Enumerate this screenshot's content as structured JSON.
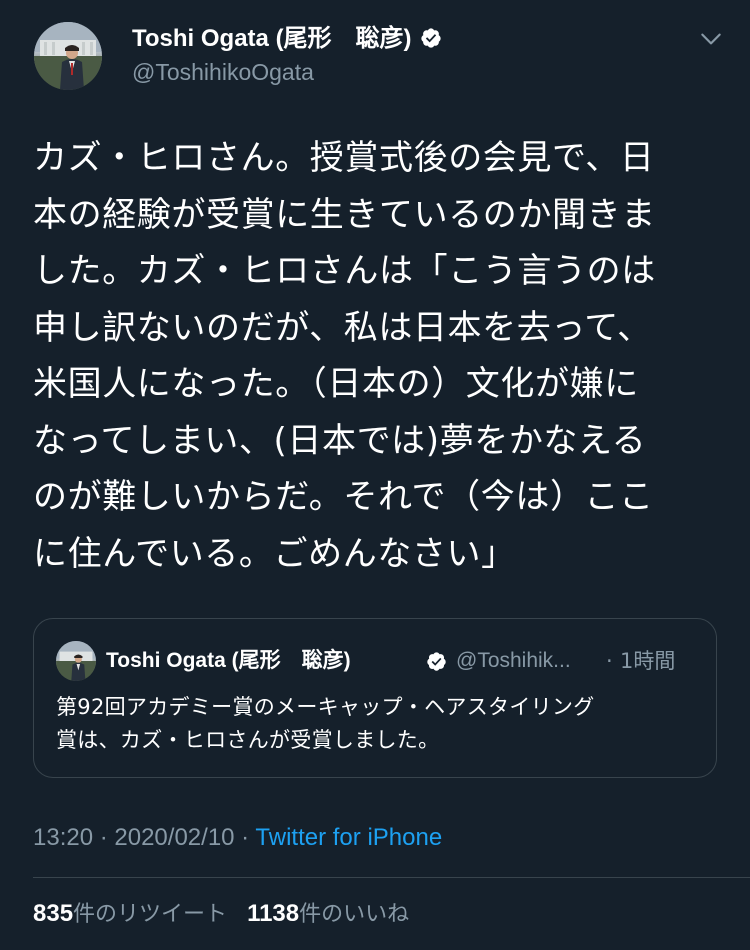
{
  "author": {
    "name": "Toshi Ogata (尾形　聡彦)",
    "handle": "@ToshihikoOgata",
    "verified": true
  },
  "tweet": {
    "lines": [
      "カズ・ヒロさん。授賞式後の会見で、日",
      "本の経験が受賞に生きているのか聞きま",
      "した。カズ・ヒロさんは「こう言うのは",
      "申し訳ないのだが、私は日本を去って、",
      "米国人になった。（日本の）文化が嫌に",
      "なってしまい、(日本では)夢をかなえる",
      "のが難しいからだ。それで（今は）ここ",
      "に住んでいる。ごめんなさい」"
    ]
  },
  "quoted_tweet": {
    "name": "Toshi Ogata (尾形　聡彦)",
    "handle": "@Toshihik...",
    "separator": "·",
    "time": "1時間",
    "lines": [
      "第92回アカデミー賞のメーキャップ・ヘアスタイリング",
      "賞は、カズ・ヒロさんが受賞しました。"
    ]
  },
  "meta": {
    "time": "13:20",
    "sep1": " · ",
    "date": "2020/02/10",
    "sep2": " · ",
    "source": "Twitter for iPhone"
  },
  "stats": {
    "retweets": "835",
    "retweets_label": "件のリツイート",
    "likes": "1138",
    "likes_label": "件のいいね"
  },
  "icons": {
    "verified": "verified-badge-icon",
    "menu": "chevron-down-icon"
  },
  "colors": {
    "background": "#15202b",
    "text": "#ffffff",
    "secondary": "#8899a6",
    "link": "#1da1f2",
    "border": "#38444d"
  }
}
